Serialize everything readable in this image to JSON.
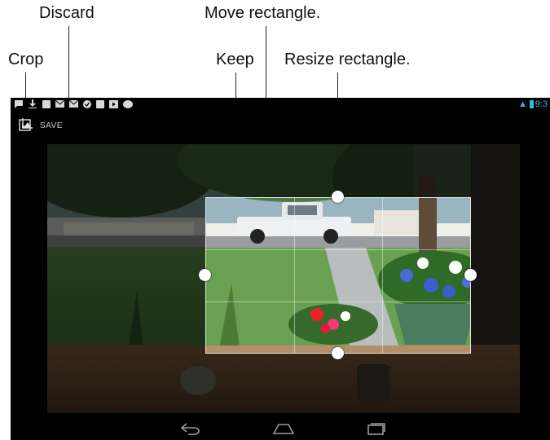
{
  "callouts": {
    "discard": "Discard",
    "move": "Move rectangle.",
    "crop": "Crop",
    "keep": "Keep",
    "resize": "Resize rectangle."
  },
  "status_bar": {
    "icons": [
      "notification-icon",
      "download-icon",
      "facebook-icon",
      "mail-icon",
      "mail-icon",
      "check-icon",
      "calendar-icon",
      "play-icon",
      "game-icon"
    ],
    "time": "9:3",
    "accent": "#35b5e5"
  },
  "action_bar": {
    "save_label": "SAVE"
  },
  "nav_bar": {
    "icons": [
      "back-icon",
      "home-icon",
      "recent-apps-icon"
    ]
  }
}
